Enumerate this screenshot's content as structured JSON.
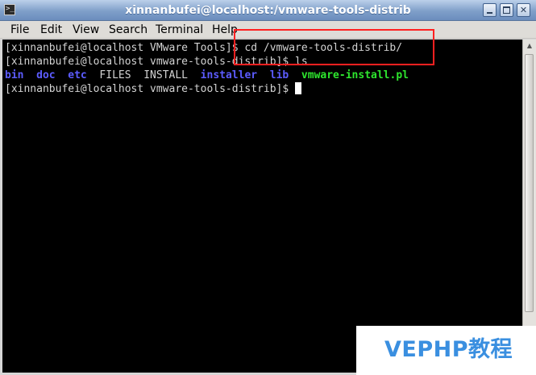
{
  "window": {
    "title": "xinnanbufei@localhost:/vmware-tools-distrib",
    "app_icon": "terminal-icon",
    "controls": {
      "minimize_icon": "minimize-icon",
      "maximize_icon": "maximize-icon",
      "close_icon": "close-icon",
      "close_glyph": "✕"
    }
  },
  "menu": {
    "items": [
      "File",
      "Edit",
      "View",
      "Search",
      "Terminal",
      "Help"
    ]
  },
  "terminal": {
    "lines": [
      {
        "prompt": "[xinnanbufei@localhost VMware Tools]$ ",
        "command": "cd /vmware-tools-distrib/"
      },
      {
        "prompt": "[xinnanbufei@localhost vmware-tools-distrib]$ ",
        "command": "ls"
      },
      {
        "prompt": "[xinnanbufei@localhost vmware-tools-distrib]$ ",
        "command": ""
      }
    ],
    "ls_output": [
      {
        "name": "bin",
        "type": "directory"
      },
      {
        "name": "doc",
        "type": "directory"
      },
      {
        "name": "etc",
        "type": "directory"
      },
      {
        "name": "FILES",
        "type": "file"
      },
      {
        "name": "INSTALL",
        "type": "file"
      },
      {
        "name": "installer",
        "type": "directory"
      },
      {
        "name": "lib",
        "type": "directory"
      },
      {
        "name": "vmware-install.pl",
        "type": "executable"
      }
    ],
    "colors": {
      "background": "#000000",
      "text": "#d3d3d3",
      "directory": "#5c5cff",
      "executable": "#2ee62e",
      "cursor": "#ffffff"
    }
  },
  "scrollbar": {
    "up_icon": "scroll-up-arrow-icon",
    "down_icon": "scroll-down-arrow-icon"
  },
  "annotation": {
    "highlight_color": "#ff2020"
  },
  "watermark": {
    "text": "VEPHP教程",
    "color": "#3a8fe0"
  }
}
